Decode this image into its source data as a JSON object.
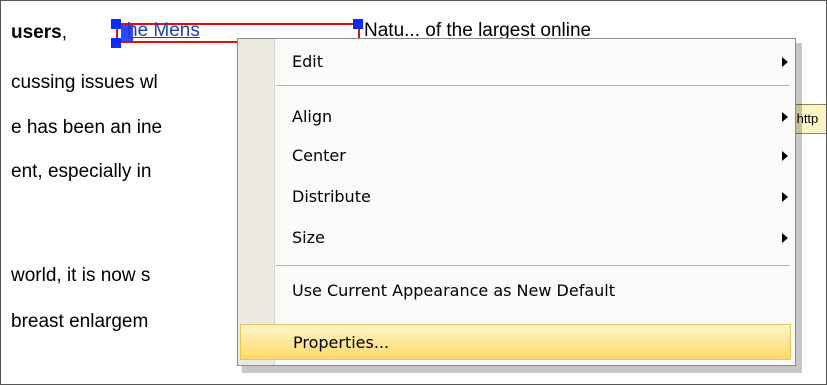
{
  "document": {
    "lines": [
      {
        "bold": "users",
        "rest": ",",
        "top": 0
      },
      {
        "text": "cussing issues wl"
      },
      {
        "text": "e has been an ine"
      },
      {
        "text": "ent, especially in"
      },
      {
        "text": "world, it is now s"
      },
      {
        "text": "breast enlargem"
      }
    ],
    "link_text": "he Mens",
    "behind_menu_text": "Natu... of the largest online",
    "tooltip_text": "<http"
  },
  "context_menu": {
    "items": [
      {
        "label": "Edit",
        "submenu": true
      },
      {
        "label": "Align",
        "submenu": true
      },
      {
        "label": "Center",
        "submenu": true
      },
      {
        "label": "Distribute",
        "submenu": true
      },
      {
        "label": "Size",
        "submenu": true
      },
      {
        "label": "Use Current Appearance as New Default",
        "submenu": false
      },
      {
        "label": "Properties...",
        "submenu": false,
        "highlighted": true
      }
    ]
  }
}
